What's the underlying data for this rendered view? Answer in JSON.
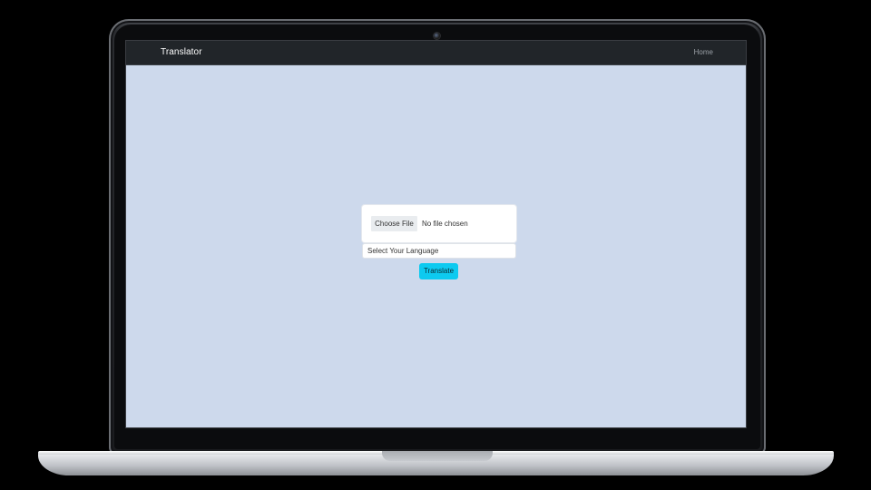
{
  "navbar": {
    "brand": "Translator",
    "links": [
      {
        "label": "Home"
      }
    ]
  },
  "form": {
    "file_input": {
      "button_label": "Choose File",
      "status_text": "No file chosen"
    },
    "language_select": {
      "selected": "Select Your Language"
    },
    "submit_label": "Translate"
  },
  "colors": {
    "page_background": "#cdd9ec",
    "navbar_background": "#212529",
    "translate_button": "#0dcaf0"
  }
}
